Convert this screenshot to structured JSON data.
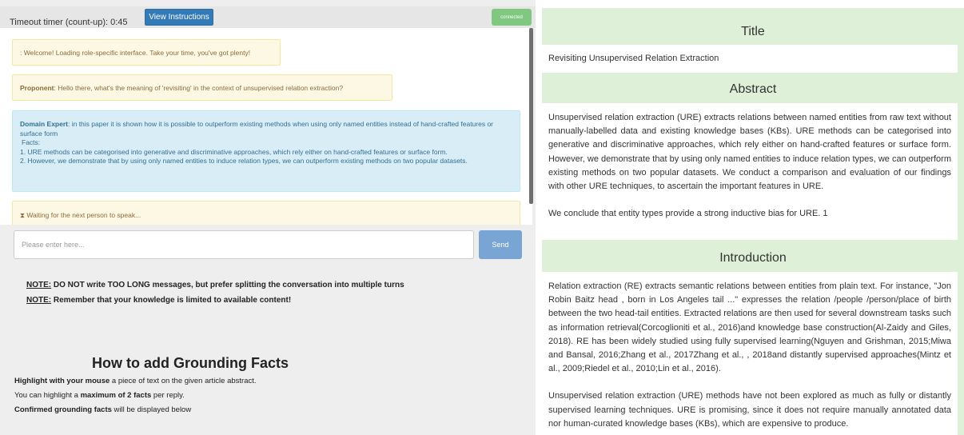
{
  "header": {
    "timer": "Timeout timer (count-up): 0:45",
    "instructions_button": "View Instructions",
    "status": "connected"
  },
  "chat": {
    "system_message": ": Welcome! Loading role-specific interface. Take your time, you've got plenty!",
    "proponent": {
      "speaker": "Proponent",
      "text": ": Hello there, what's the meaning of 'revisiting' in the context of unsupervised relation extraction?"
    },
    "expert": {
      "speaker": "Domain Expert",
      "text": ": in this paper it is shown how it is possible to outperform existing methods when using only named entities instead of hand-crafted features or surface form",
      "facts_label": "Facts:",
      "fact1": "1. URE methods can be categorised into generative and discriminative approaches, which rely either on hand-crafted features or surface form.",
      "fact2": "2. However, we demonstrate that by using only named entities to induce relation types, we can outperform existing methods on two popular datasets."
    },
    "waiting_icon": "hourglass-icon",
    "waiting": "Waiting for the next person to speak..."
  },
  "composer": {
    "placeholder": "Please enter here...",
    "value": "",
    "send_label": "Send"
  },
  "notes": [
    {
      "label": "NOTE:",
      "text": " DO NOT write TOO LONG messages, but prefer splitting the conversation into multiple turns"
    },
    {
      "label": "NOTE:",
      "text": " Remember that your knowledge is limited to available content!"
    }
  ],
  "grounding": {
    "title": "How to add Grounding Facts",
    "line1_bold": "Highlight with your mouse",
    "line1_rest": " a piece of text on the given article abstract.",
    "line2_pre": "You can highlight a ",
    "line2_bold": "maximum of 2 facts",
    "line2_post": " per reply.",
    "line3_bold": "Confirmed grounding facts",
    "line3_rest": " will be displayed below"
  },
  "article": {
    "title_heading": "Title",
    "title": "Revisiting Unsupervised Relation Extraction",
    "abstract_heading": "Abstract",
    "abstract_p1": "Unsupervised relation extraction (URE) extracts relations between named entities from raw text without manually-labelled data and existing knowledge bases (KBs). URE methods can be categorised into generative and discriminative approaches, which rely either on hand-crafted features or surface form. However, we demonstrate that by using only named entities to induce relation types, we can outperform existing methods on two popular datasets. We conduct a comparison and evaluation of our findings with other URE techniques, to ascertain the important features in URE.",
    "abstract_p2": "We conclude that entity types provide a strong inductive bias for URE. 1",
    "intro_heading": "Introduction",
    "intro_p1": "Relation extraction (RE) extracts semantic relations between entities from plain text. For instance, \"Jon Robin Baitz head , born in Los Angeles tail ...\" expresses the relation /people /person/place of birth between the two head-tail entities. Extracted relations are then used for several downstream tasks such as information retrieval(Corcoglioniti et al., 2016)and knowledge base construction(Al-Zaidy and Giles, 2018). RE has been widely studied using fully supervised learning(Nguyen and Grishman, 2015;Miwa and Bansal, 2016;Zhang et al., 2017Zhang et al., , 2018and distantly supervised approaches(Mintz et al., 2009;Riedel et al., 2010;Lin et al., 2016).",
    "intro_p2": "Unsupervised relation extraction (URE) methods have not been explored as much as fully or distantly supervised learning techniques. URE is promising, since it does not require manually annotated data nor human-curated knowledge bases (KBs), which are expensive to produce."
  }
}
